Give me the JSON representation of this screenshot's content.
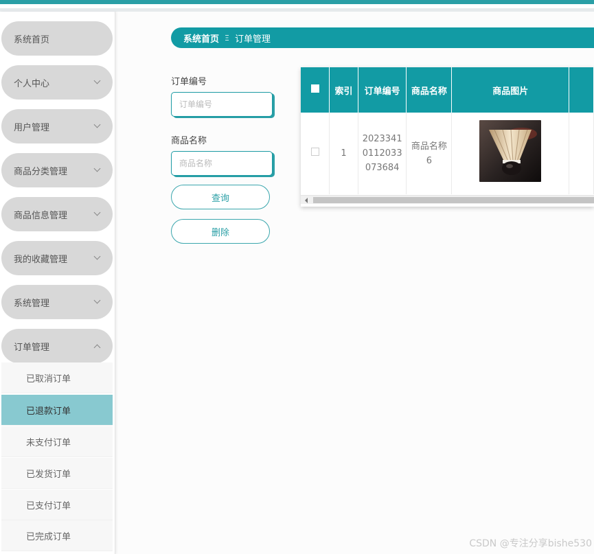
{
  "sidebar": {
    "items": [
      {
        "label": "系统首页",
        "expanded": null
      },
      {
        "label": "个人中心",
        "expanded": false
      },
      {
        "label": "用户管理",
        "expanded": false
      },
      {
        "label": "商品分类管理",
        "expanded": false
      },
      {
        "label": "商品信息管理",
        "expanded": false
      },
      {
        "label": "我的收藏管理",
        "expanded": false
      },
      {
        "label": "系统管理",
        "expanded": false
      },
      {
        "label": "订单管理",
        "expanded": true
      }
    ],
    "subitems": [
      {
        "label": "已取消订单",
        "active": false
      },
      {
        "label": "已退款订单",
        "active": true
      },
      {
        "label": "未支付订单",
        "active": false
      },
      {
        "label": "已发货订单",
        "active": false
      },
      {
        "label": "已支付订单",
        "active": false
      },
      {
        "label": "已完成订单",
        "active": false
      }
    ]
  },
  "breadcrumb": {
    "home": "系统首页",
    "separator": "Ξ",
    "current": "订单管理"
  },
  "search": {
    "order_no_label": "订单编号",
    "order_no_placeholder": "订单编号",
    "product_name_label": "商品名称",
    "product_name_placeholder": "商品名称",
    "query_button": "查询",
    "delete_button": "删除"
  },
  "table": {
    "headers": [
      "索引",
      "订单编号",
      "商品名称",
      "商品图片"
    ],
    "rows": [
      {
        "index": "1",
        "order_no_lines": [
          "2023341",
          "0112033",
          "073684"
        ],
        "product_name_lines": [
          "商品名称",
          "6"
        ],
        "image": "shuttlecock-image"
      }
    ]
  },
  "watermark": "CSDN @专注分享bishe530",
  "colors": {
    "accent": "#129ba4",
    "top_border": "#2a9fa6",
    "active_subitem": "#88c9d0",
    "menu_pill": "#d8d8d8"
  }
}
